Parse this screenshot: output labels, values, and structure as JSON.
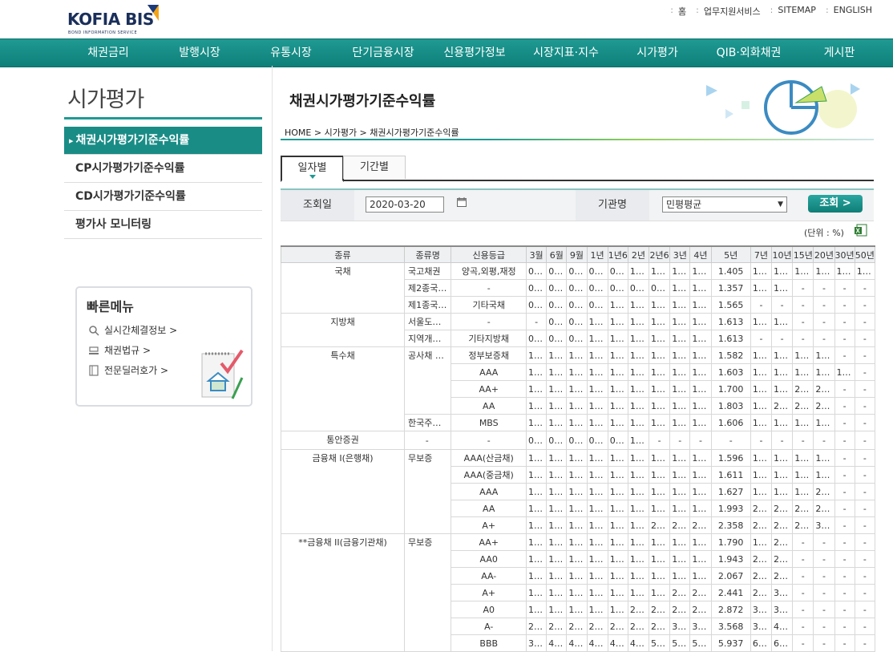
{
  "header": {
    "logo_text": "KOFIA BIS",
    "logo_sub": "BOND INFORMATION SERVICE",
    "util": [
      "홈",
      "업무지원서비스",
      "SITEMAP",
      "ENGLISH"
    ]
  },
  "gnb": [
    "채권금리",
    "발행시장",
    "유통시장",
    "단기금융시장",
    "신용평가정보",
    "시장지표·지수",
    "시가평가",
    "QIB·외화채권",
    "게시판"
  ],
  "sidebar": {
    "title": "시가평가",
    "items": [
      {
        "label": "채권시가평가기준수익률",
        "active": true
      },
      {
        "label": "CP시가평가기준수익률",
        "active": false
      },
      {
        "label": "CD시가평가기준수익률",
        "active": false
      },
      {
        "label": "평가사 모니터링",
        "active": false
      }
    ]
  },
  "quick_menu": {
    "title": "빠른메뉴",
    "items": [
      {
        "label": "실시간체결정보 >",
        "icon": "magnifier-icon"
      },
      {
        "label": "채권법규 >",
        "icon": "gavel-icon"
      },
      {
        "label": "전문딜러호가 >",
        "icon": "book-icon"
      }
    ]
  },
  "main": {
    "title": "채권시가평가기준수익률",
    "breadcrumb": "HOME > 시가평가 > 채권시가평가기준수익률",
    "tabs": [
      "일자별",
      "기간별"
    ],
    "search": {
      "date_label": "조회일",
      "date_value": "2020-03-20",
      "org_label": "기관명",
      "org_value": "민평평균",
      "button": "조회 >"
    },
    "unit": "(단위 : %)"
  },
  "table": {
    "headers": [
      "종류",
      "종류명",
      "신용등급",
      "3월",
      "6월",
      "9월",
      "1년",
      "1년6",
      "2년",
      "2년6",
      "3년",
      "4년",
      "5년",
      "7년",
      "10년",
      "15년",
      "20년",
      "30년",
      "50년"
    ],
    "rows": [
      {
        "type": "국채",
        "type_span": 3,
        "name": "국고채권",
        "grade": "양곡,외평,재정",
        "v": [
          "0.…",
          "0.…",
          "0.…",
          "0.…",
          "0.…",
          "1.…",
          "1.…",
          "1.…",
          "1.…",
          "1.405",
          "1.…",
          "1.…",
          "1.…",
          "1.…",
          "1.…",
          "1.…"
        ]
      },
      {
        "name": "제2종국…",
        "grade": "-",
        "v": [
          "0.…",
          "0.…",
          "0.…",
          "0.…",
          "0.…",
          "0.…",
          "0.…",
          "1.…",
          "1.…",
          "1.357",
          "1.…",
          "1.…",
          "-",
          "-",
          "-",
          "-"
        ]
      },
      {
        "name": "제1종국…",
        "grade": "기타국채",
        "v": [
          "0.…",
          "0.…",
          "0.…",
          "0.…",
          "1.…",
          "1.…",
          "1.…",
          "1.…",
          "1.…",
          "1.565",
          "-",
          "-",
          "-",
          "-",
          "-",
          "-"
        ]
      },
      {
        "type": "지방채",
        "type_span": 2,
        "name": "서울도…",
        "grade": "-",
        "v": [
          "-",
          "0.…",
          "0.…",
          "1.…",
          "1.…",
          "1.…",
          "1.…",
          "1.…",
          "1.…",
          "1.613",
          "1.…",
          "1.…",
          "-",
          "-",
          "-",
          "-"
        ]
      },
      {
        "name": "지역개…",
        "grade": "기타지방채",
        "v": [
          "0.…",
          "0.…",
          "0.…",
          "1.…",
          "1.…",
          "1.…",
          "1.…",
          "1.…",
          "1.…",
          "1.613",
          "-",
          "-",
          "-",
          "-",
          "-",
          "-"
        ]
      },
      {
        "type": "특수채",
        "type_span": 5,
        "name": "공사채 …",
        "name_span": 4,
        "grade": "정부보증채",
        "v": [
          "1.…",
          "1.…",
          "1.…",
          "1.…",
          "1.…",
          "1.…",
          "1.…",
          "1.…",
          "1.…",
          "1.582",
          "1.…",
          "1.…",
          "1.…",
          "1.…",
          "-",
          "-"
        ]
      },
      {
        "grade": "AAA",
        "v": [
          "1.…",
          "1.…",
          "1.…",
          "1.…",
          "1.…",
          "1.…",
          "1.…",
          "1.…",
          "1.…",
          "1.603",
          "1.…",
          "1.…",
          "1.…",
          "1.…",
          "1.…",
          "-"
        ]
      },
      {
        "grade": "AA+",
        "v": [
          "1.…",
          "1.…",
          "1.…",
          "1.…",
          "1.…",
          "1.…",
          "1.…",
          "1.…",
          "1.…",
          "1.700",
          "1.…",
          "1.…",
          "2.…",
          "2.…",
          "-",
          "-"
        ]
      },
      {
        "grade": "AA",
        "v": [
          "1.…",
          "1.…",
          "1.…",
          "1.…",
          "1.…",
          "1.…",
          "1.…",
          "1.…",
          "1.…",
          "1.803",
          "1.…",
          "2.…",
          "2.…",
          "2.…",
          "-",
          "-"
        ]
      },
      {
        "name": "한국주…",
        "grade": "MBS",
        "v": [
          "1.…",
          "1.…",
          "1.…",
          "1.…",
          "1.…",
          "1.…",
          "1.…",
          "1.…",
          "1.…",
          "1.606",
          "1.…",
          "1.…",
          "1.…",
          "1.…",
          "-",
          "-"
        ]
      },
      {
        "type": "통안증권",
        "type_span": 1,
        "name": "-",
        "grade": "-",
        "v": [
          "0.…",
          "0.…",
          "0.…",
          "0.…",
          "0.…",
          "1.…",
          "-",
          "-",
          "-",
          "-",
          "-",
          "-",
          "-",
          "-",
          "-",
          "-"
        ]
      },
      {
        "type": "금융채 I(은행채)",
        "type_span": 5,
        "name": "무보증",
        "name_span": 5,
        "grade": "AAA(산금채)",
        "v": [
          "1.…",
          "1.…",
          "1.…",
          "1.…",
          "1.…",
          "1.…",
          "1.…",
          "1.…",
          "1.…",
          "1.596",
          "1.…",
          "1.…",
          "1.…",
          "1.…",
          "-",
          "-"
        ]
      },
      {
        "grade": "AAA(중금채)",
        "v": [
          "1.…",
          "1.…",
          "1.…",
          "1.…",
          "1.…",
          "1.…",
          "1.…",
          "1.…",
          "1.…",
          "1.611",
          "1.…",
          "1.…",
          "1.…",
          "1.…",
          "-",
          "-"
        ]
      },
      {
        "grade": "AAA",
        "v": [
          "1.…",
          "1.…",
          "1.…",
          "1.…",
          "1.…",
          "1.…",
          "1.…",
          "1.…",
          "1.…",
          "1.627",
          "1.…",
          "1.…",
          "1.…",
          "2.…",
          "-",
          "-"
        ]
      },
      {
        "grade": "AA",
        "v": [
          "1.…",
          "1.…",
          "1.…",
          "1.…",
          "1.…",
          "1.…",
          "1.…",
          "1.…",
          "1.…",
          "1.993",
          "2.…",
          "2.…",
          "2.…",
          "2.…",
          "-",
          "-"
        ]
      },
      {
        "grade": "A+",
        "v": [
          "1.…",
          "1.…",
          "1.…",
          "1.…",
          "1.…",
          "1.…",
          "2.…",
          "2.…",
          "2.…",
          "2.358",
          "2.…",
          "2.…",
          "2.…",
          "3.…",
          "-",
          "-"
        ]
      },
      {
        "type": "**금융채 II(금융기관채)",
        "type_span": 7,
        "name": "무보증",
        "name_span": 7,
        "grade": "AA+",
        "v": [
          "1.…",
          "1.…",
          "1.…",
          "1.…",
          "1.…",
          "1.…",
          "1.…",
          "1.…",
          "1.…",
          "1.790",
          "1.…",
          "2.…",
          "-",
          "-",
          "-",
          "-"
        ]
      },
      {
        "grade": "AA0",
        "v": [
          "1.…",
          "1.…",
          "1.…",
          "1.…",
          "1.…",
          "1.…",
          "1.…",
          "1.…",
          "1.…",
          "1.943",
          "2.…",
          "2.…",
          "-",
          "-",
          "-",
          "-"
        ]
      },
      {
        "grade": "AA-",
        "v": [
          "1.…",
          "1.…",
          "1.…",
          "1.…",
          "1.…",
          "1.…",
          "1.…",
          "1.…",
          "1.…",
          "2.067",
          "2.…",
          "2.…",
          "-",
          "-",
          "-",
          "-"
        ]
      },
      {
        "grade": "A+",
        "v": [
          "1.…",
          "1.…",
          "1.…",
          "1.…",
          "1.…",
          "1.…",
          "1.…",
          "2.…",
          "2.…",
          "2.441",
          "2.…",
          "3.…",
          "-",
          "-",
          "-",
          "-"
        ]
      },
      {
        "grade": "A0",
        "v": [
          "1.…",
          "1.…",
          "1.…",
          "1.…",
          "1.…",
          "2.…",
          "2.…",
          "2.…",
          "2.…",
          "2.872",
          "3.…",
          "3.…",
          "-",
          "-",
          "-",
          "-"
        ]
      },
      {
        "grade": "A-",
        "v": [
          "2.…",
          "2.…",
          "2.…",
          "2.…",
          "2.…",
          "2.…",
          "2.…",
          "3.…",
          "3.…",
          "3.568",
          "3.…",
          "4.…",
          "-",
          "-",
          "-",
          "-"
        ]
      },
      {
        "grade": "BBB",
        "v": [
          "3.…",
          "4.…",
          "4.…",
          "4.…",
          "4.…",
          "4.…",
          "5.…",
          "5.…",
          "5.…",
          "5.937",
          "6.…",
          "6.…",
          "-",
          "-",
          "-",
          "-"
        ]
      }
    ]
  },
  "colors": {
    "brand_teal": "#1a8c86",
    "nav": "#149089"
  }
}
